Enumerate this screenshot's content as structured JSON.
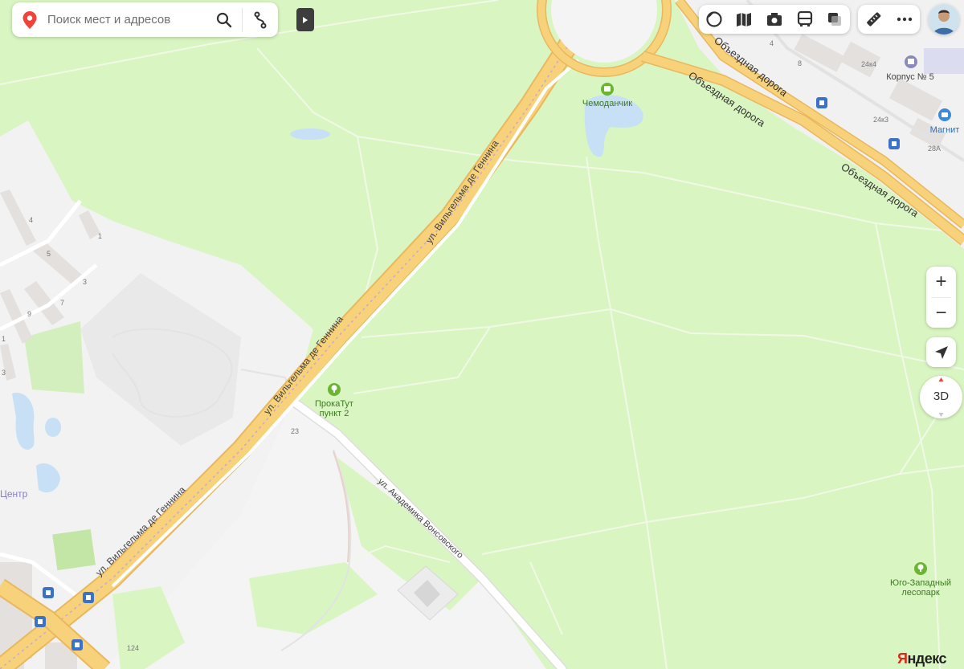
{
  "search": {
    "placeholder": "Поиск мест и адресов"
  },
  "map": {
    "streets": {
      "dennin_top": "ул. Вильгельма де Геннина",
      "dennin_mid": "ул. Вильгельма де Геннина",
      "dennin_low": "ул. Вильгельма де Геннина",
      "ring_a": "Объездная дорога",
      "ring_b": "Объездная дорога",
      "ring_c": "Объездная дорога",
      "vonsovskogo": "ул. Академика Вонсовского"
    },
    "pois": {
      "chemodanchik": "Чемоданчик",
      "prokatut_1": "ПрокаТут",
      "prokatut_2": "пункт 2",
      "park_1": "Юго-Западный",
      "park_2": "лесопарк",
      "korpus": "Корпус № 5",
      "magnit": "Магнит",
      "centre": "Центр"
    },
    "house_numbers": {
      "h4": "4",
      "h1": "1",
      "h5": "5",
      "h3": "3",
      "h7": "7",
      "h9": "9",
      "h1b": "1",
      "h3b": "3",
      "h23": "23",
      "h124": "124",
      "r4": "4",
      "r8": "8",
      "r24k4": "24к4",
      "r24k3": "24к3",
      "r28a": "28А"
    }
  },
  "controls": {
    "zoom_in": "+",
    "zoom_out": "−",
    "view_3d": "3D"
  },
  "branding": {
    "logo_red": "Я",
    "logo_rest": "ндекс"
  },
  "colors": {
    "park": "#d9f5c1",
    "urban": "#f2f2f2",
    "road": "#f7d27a",
    "road_edge": "#eab75d",
    "water": "#c8e0f5",
    "poi": "#6bb532"
  }
}
